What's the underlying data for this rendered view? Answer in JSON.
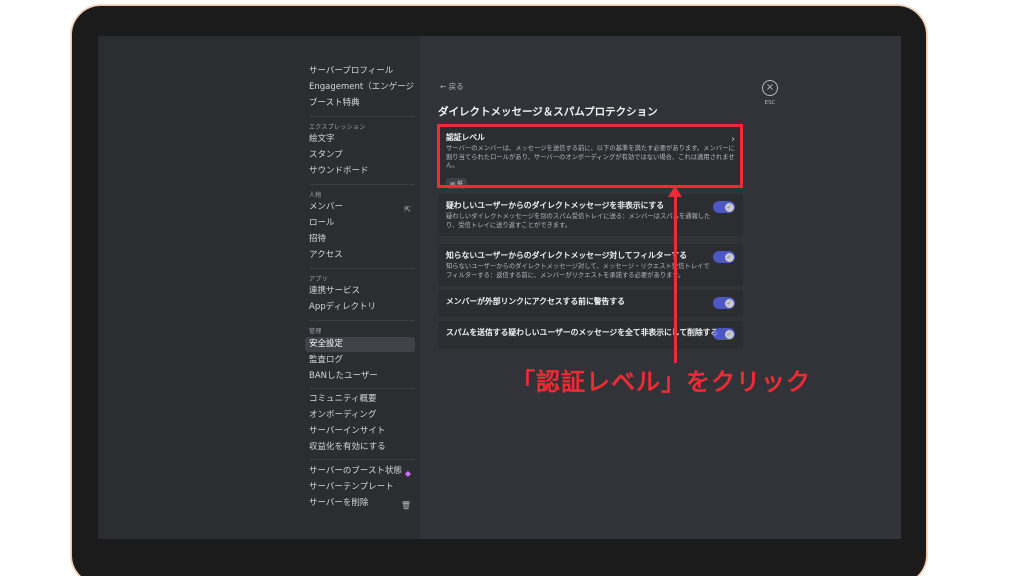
{
  "sidebar": {
    "items": [
      {
        "label": "サーバープロフィール"
      },
      {
        "label": "Engagement（エンゲージメ..."
      },
      {
        "label": "ブースト特典"
      }
    ],
    "expression": {
      "header": "エクスプレッション",
      "items": [
        {
          "label": "絵文字"
        },
        {
          "label": "スタンプ"
        },
        {
          "label": "サウンドボード"
        }
      ]
    },
    "people": {
      "header": "人物",
      "items": [
        {
          "label": "メンバー"
        },
        {
          "label": "ロール"
        },
        {
          "label": "招待"
        },
        {
          "label": "アクセス"
        }
      ]
    },
    "apps": {
      "header": "アプリ",
      "items": [
        {
          "label": "連携サービス"
        },
        {
          "label": "Appディレクトリ"
        }
      ]
    },
    "moderation": {
      "header": "管理",
      "items": [
        {
          "label": "安全設定"
        },
        {
          "label": "監査ログ"
        },
        {
          "label": "BANしたユーザー"
        }
      ]
    },
    "community": {
      "items": [
        {
          "label": "コミュニティ概要"
        },
        {
          "label": "オンボーディング"
        },
        {
          "label": "サーバーインサイト"
        },
        {
          "label": "収益化を有効にする"
        }
      ]
    },
    "server": {
      "items": [
        {
          "label": "サーバーのブースト状態"
        },
        {
          "label": "サーバーテンプレート"
        },
        {
          "label": "サーバーを削除"
        }
      ]
    }
  },
  "main": {
    "back_label": "戻る",
    "title": "ダイレクトメッセージ＆スパムプロテクション",
    "esc_label": "ESC",
    "verification": {
      "title": "認証レベル",
      "desc": "サーバーのメンバーは、メッセージを送信する前に、以下の基準を満たす必要があります。メンバーに割り当てられたロールがあり、サーバーのオンボーディングが有効ではない場合、これは適用されません。",
      "badge": "低"
    },
    "toggles": [
      {
        "title": "疑わしいユーザーからのダイレクトメッセージを非表示にする",
        "desc": "疑わしいダイレクトメッセージを別のスパム受信トレイに送る：メンバーはスパムを通報したり、受信トレイに送り返すことができます。"
      },
      {
        "title": "知らないユーザーからのダイレクトメッセージ対してフィルターする",
        "desc": "知らないユーザーからのダイレクトメッセージ対して、メッセージ・リクエスト受信トレイでフィルターする：返信する前に、メンバーがリクエストを承諾する必要があります。"
      },
      {
        "title": "メンバーが外部リンクにアクセスする前に警告する",
        "desc": ""
      },
      {
        "title": "スパムを送信する疑わしいユーザーのメッセージを全て非表示にして削除する",
        "desc": ""
      }
    ]
  },
  "annotation": {
    "callout": "「認証レベル」をクリック",
    "color": "#ef2b33"
  },
  "colors": {
    "sidebar_bg": "#2b2d31",
    "main_bg": "#313338",
    "toggle_on": "#5865f2"
  }
}
